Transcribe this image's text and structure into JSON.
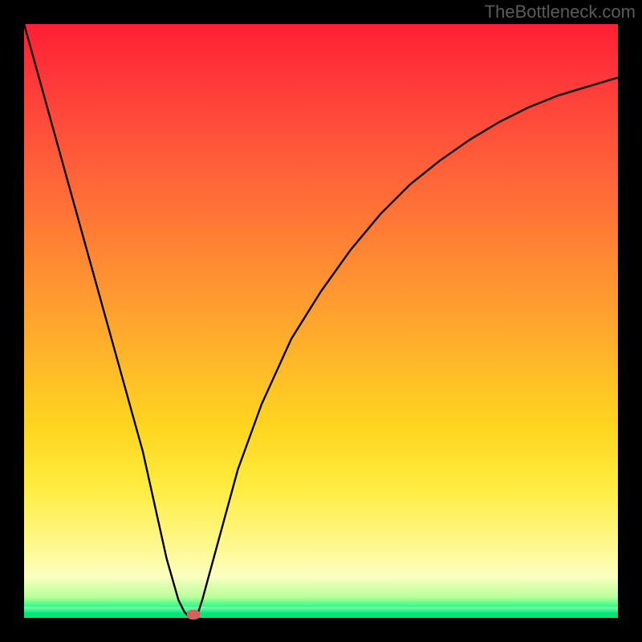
{
  "attribution": "TheBottleneck.com",
  "chart_data": {
    "type": "line",
    "title": "",
    "xlabel": "",
    "ylabel": "",
    "xlim": [
      0,
      100
    ],
    "ylim": [
      0,
      100
    ],
    "x": [
      0,
      5,
      10,
      15,
      20,
      24,
      26,
      27,
      28,
      29,
      30,
      33,
      36,
      40,
      45,
      50,
      55,
      60,
      65,
      70,
      75,
      80,
      85,
      90,
      95,
      100
    ],
    "values": [
      100,
      82,
      64,
      46,
      28,
      10,
      3,
      1,
      0,
      0,
      3,
      14,
      25,
      36,
      47,
      55,
      62,
      68,
      73,
      77,
      80.5,
      83.5,
      86,
      88,
      89.5,
      91
    ],
    "marker": {
      "x": 28.5,
      "y": 0
    },
    "gradient_stops": [
      {
        "pos": 0,
        "color": "#ff1f34"
      },
      {
        "pos": 0.46,
        "color": "#ff9a30"
      },
      {
        "pos": 0.78,
        "color": "#ffec40"
      },
      {
        "pos": 0.97,
        "color": "#b9ff9b"
      },
      {
        "pos": 1.0,
        "color": "#00ff80"
      }
    ]
  }
}
